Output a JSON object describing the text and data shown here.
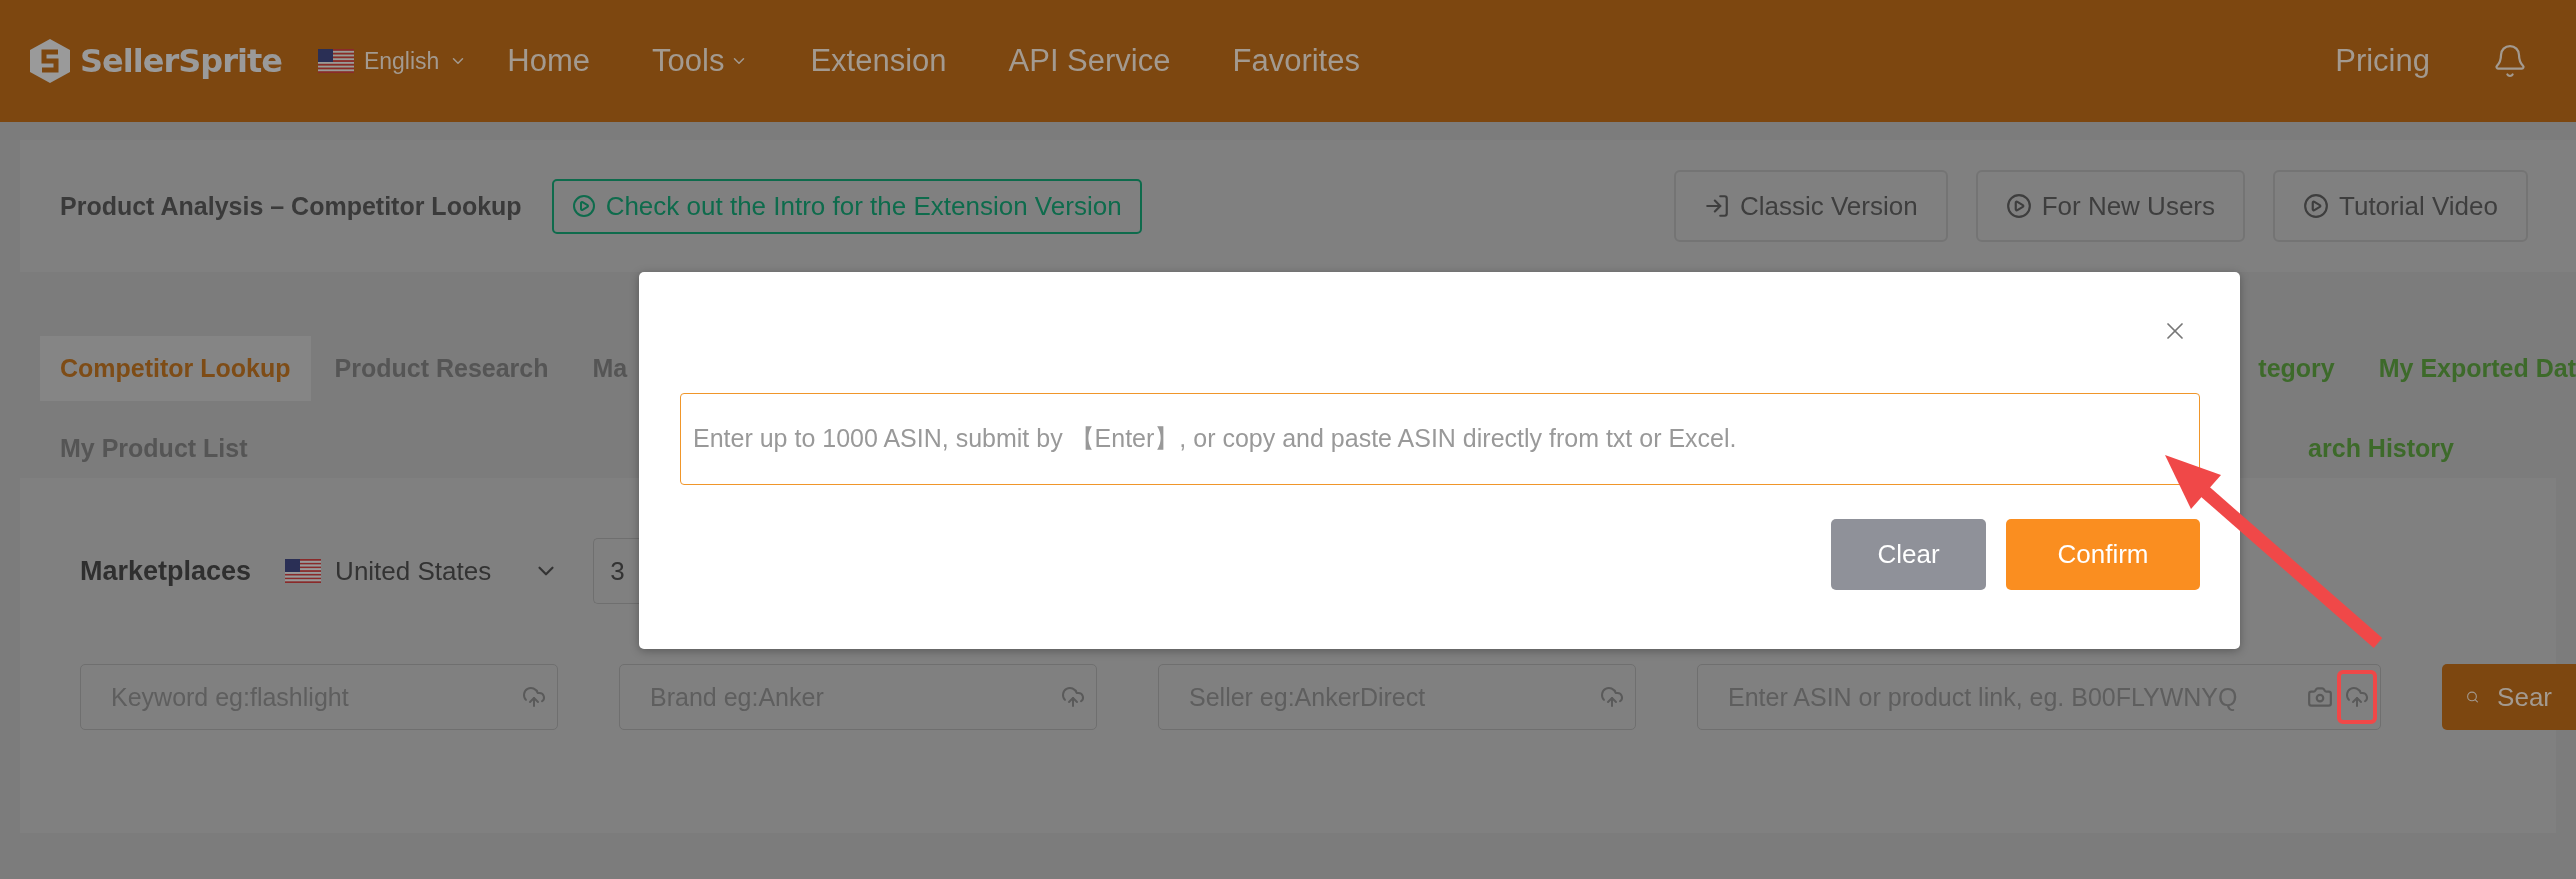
{
  "nav": {
    "logo": "SellerSprite",
    "language": "English",
    "items": [
      {
        "label": "Home",
        "dropdown": false
      },
      {
        "label": "Tools",
        "dropdown": true
      },
      {
        "label": "Extension",
        "dropdown": false
      },
      {
        "label": "API Service",
        "dropdown": false
      },
      {
        "label": "Favorites",
        "dropdown": false
      }
    ],
    "pricing": "Pricing"
  },
  "header": {
    "title": "Product Analysis – Competitor Lookup",
    "intro_link": "Check out the Intro for the Extension Version",
    "buttons": [
      {
        "label": "Classic Version",
        "kind": "exit"
      },
      {
        "label": "For New Users",
        "kind": "play"
      },
      {
        "label": "Tutorial Video",
        "kind": "play"
      }
    ]
  },
  "tab_rows": [
    {
      "left": [
        {
          "label": "Competitor Lookup",
          "selected": true
        },
        {
          "label": "Product Research",
          "selected": false
        },
        {
          "label": "Ma",
          "selected": false
        }
      ],
      "right": [
        {
          "label": "tegory"
        },
        {
          "label": "My Exported Dat"
        }
      ]
    },
    {
      "left": [
        {
          "label": "My Product List",
          "selected": false
        }
      ],
      "right": [
        {
          "label": "arch History"
        }
      ]
    }
  ],
  "search": {
    "label": "Marketplaces",
    "marketplace": "United States",
    "select_value": "3",
    "fields": [
      {
        "placeholder": "Keyword eg:flashlight",
        "camera": false,
        "highlighted": false
      },
      {
        "placeholder": "Brand eg:Anker",
        "camera": false,
        "highlighted": false
      },
      {
        "placeholder": "Seller eg:AnkerDirect",
        "camera": false,
        "highlighted": false
      },
      {
        "placeholder": "Enter ASIN or product link, eg. B00FLYWNYQ",
        "camera": true,
        "highlighted": true
      }
    ],
    "button": "Sear"
  },
  "dialog": {
    "placeholder": "Enter up to 1000 ASIN, submit by 【Enter】, or copy and paste ASIN directly from txt or Excel.",
    "buttons": [
      {
        "label": "Clear",
        "kind": "secondary"
      },
      {
        "label": "Confirm",
        "kind": "primary"
      }
    ]
  }
}
